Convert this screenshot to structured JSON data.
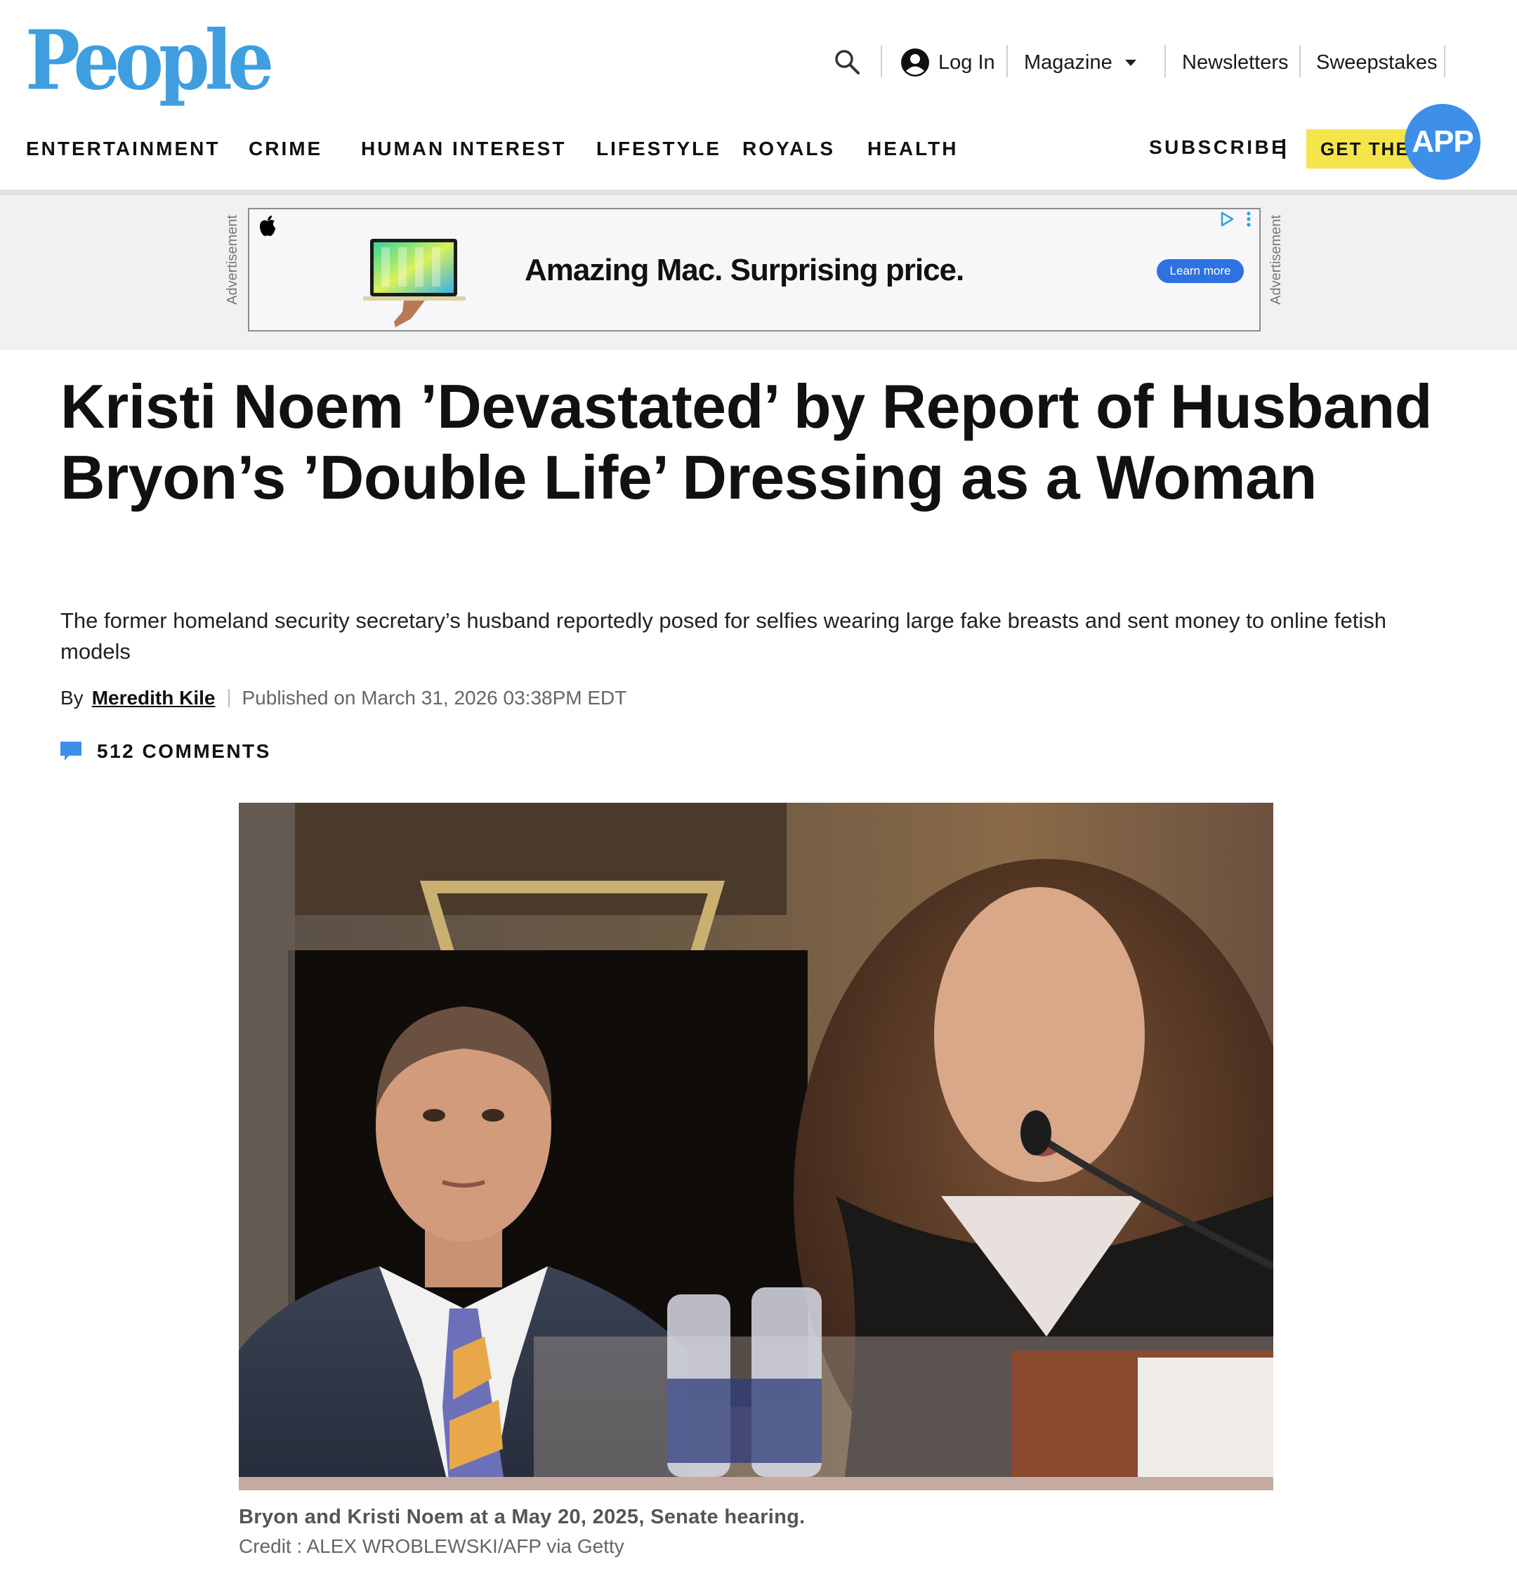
{
  "header": {
    "logo": "People",
    "utility": {
      "search_icon": "search-icon",
      "login": "Log In",
      "login_icon": "account-circle-icon",
      "magazine": "Magazine",
      "newsletters": "Newsletters",
      "sweepstakes": "Sweepstakes"
    },
    "nav": [
      "ENTERTAINMENT",
      "CRIME",
      "HUMAN INTEREST",
      "LIFESTYLE",
      "ROYALS",
      "HEALTH"
    ],
    "subscribe": "SUBSCRIBE",
    "get_the": "GET THE",
    "app": "APP"
  },
  "ad": {
    "label": "Advertisement",
    "brand_icon": "apple-logo-icon",
    "headline": "Amazing Mac. Surprising price.",
    "cta": "Learn more"
  },
  "article": {
    "headline": "Kristi Noem ’Devastated’ by Report of Husband Bryon’s ’Double Life’ Dressing as a Woman",
    "dek": "The former homeland security secretary’s husband reportedly posed for selfies wearing large fake breasts and sent money to online fetish models",
    "by": "By",
    "author": "Meredith Kile",
    "published": "Published on March 31, 2026 03:38PM EDT",
    "comments": "512 COMMENTS",
    "image_caption": "Bryon and Kristi Noem at a May 20, 2025, Senate hearing.",
    "image_credit": "Credit : ALEX WROBLEWSKI/AFP via Getty"
  },
  "colors": {
    "brand_blue": "#3e9ee0",
    "app_yellow": "#f5e54a",
    "app_blue": "#3e8fe8",
    "ad_cta_blue": "#2d72e0"
  }
}
